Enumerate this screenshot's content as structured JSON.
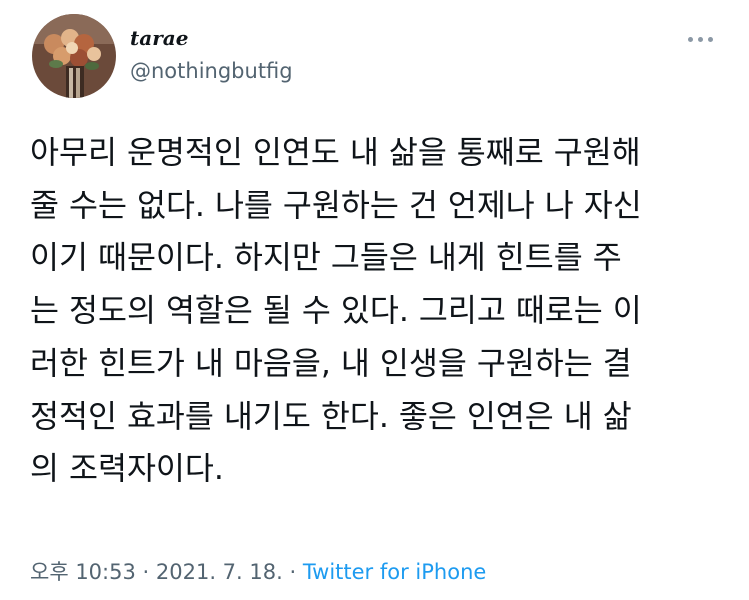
{
  "user": {
    "display_name": "tarae",
    "handle": "@nothingbutfig",
    "avatar_icon": "bouquet-photo"
  },
  "tweet": {
    "lines": [
      "아무리 운명적인 인연도 내 삶을 통째로 구원해",
      "줄 수는 없다. 나를 구원하는 건 언제나 나 자신",
      "이기 때문이다. 하지만 그들은 내게 힌트를 주",
      "는 정도의 역할은 될 수 있다. 그리고 때로는 이",
      "러한 힌트가 내 마음을, 내 인생을 구원하는 결",
      "정적인 효과를 내기도 한다. 좋은 인연은 내 삶",
      "의 조력자이다."
    ]
  },
  "meta": {
    "time": "오후 10:53",
    "separator1": " · ",
    "date": "2021. 7. 18.",
    "separator2": " · ",
    "source": "Twitter for iPhone"
  },
  "colors": {
    "text": "#0f1419",
    "secondary": "#536471",
    "link": "#1d9bf0"
  }
}
